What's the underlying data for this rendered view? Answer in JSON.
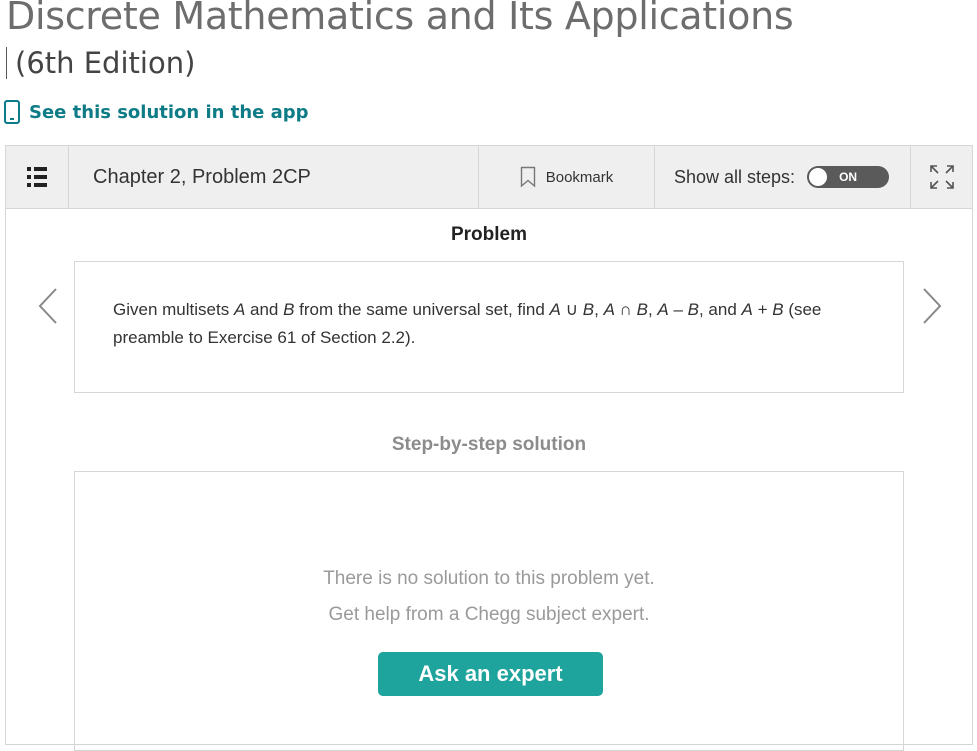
{
  "book": {
    "title": "Discrete Mathematics and Its Applications",
    "edition": "(6th Edition)"
  },
  "app_link": {
    "label": "See this solution in the app",
    "icon": "phone-icon"
  },
  "toolbar": {
    "menu_icon": "list-icon",
    "chapter": "Chapter 2, Problem 2CP",
    "bookmark_label": "Bookmark",
    "show_steps_label": "Show all steps:",
    "toggle_label": "ON",
    "expand_icon": "expand-icon"
  },
  "problem": {
    "title": "Problem",
    "text": {
      "p1": "Given multisets ",
      "A1": "A",
      "p2": " and ",
      "B1": "B",
      "p3": " from the same universal set, find ",
      "A2": "A",
      "p4": " ∪ ",
      "B2": "B",
      "p5": ", ",
      "A3": "A",
      "p6": " ∩ ",
      "B3": "B",
      "p7": ", ",
      "A4": "A",
      "p8": " – ",
      "B4": "B",
      "p9": ", and ",
      "A5": "A",
      "p10": " + ",
      "B5": "B",
      "p11": " (see preamble to Exercise 61 of Section 2.2)."
    }
  },
  "solution": {
    "title": "Step-by-step solution",
    "no_solution": "There is no solution to this problem yet.",
    "get_help": "Get help from a Chegg subject expert.",
    "ask_button": "Ask an expert"
  },
  "colors": {
    "accent_teal": "#0e7c86",
    "button_teal": "#1fa39d",
    "toolbar_bg": "#efefef"
  }
}
